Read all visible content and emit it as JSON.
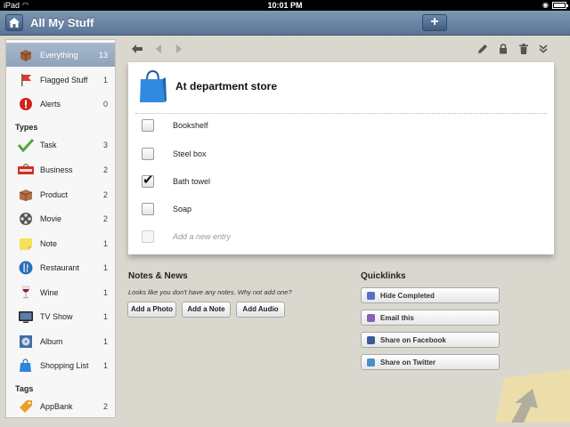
{
  "status": {
    "carrier": "iPad",
    "time": "10:01 PM"
  },
  "nav": {
    "title": "All My Stuff",
    "add_label": "+"
  },
  "sidebar": {
    "items": [
      {
        "label": "Everything",
        "count": "13",
        "icon": "box-icon"
      },
      {
        "label": "Flagged Stuff",
        "count": "1",
        "icon": "flag-icon"
      },
      {
        "label": "Alerts",
        "count": "0",
        "icon": "alert-icon"
      }
    ],
    "types_header": "Types",
    "types": [
      {
        "label": "Task",
        "count": "3",
        "icon": "checkmark-icon"
      },
      {
        "label": "Business",
        "count": "2",
        "icon": "open-sign-icon"
      },
      {
        "label": "Product",
        "count": "2",
        "icon": "package-icon"
      },
      {
        "label": "Movie",
        "count": "2",
        "icon": "film-reel-icon"
      },
      {
        "label": "Note",
        "count": "1",
        "icon": "sticky-note-icon"
      },
      {
        "label": "Restaurant",
        "count": "1",
        "icon": "fork-knife-icon"
      },
      {
        "label": "Wine",
        "count": "1",
        "icon": "wine-glass-icon"
      },
      {
        "label": "TV Show",
        "count": "1",
        "icon": "tv-icon"
      },
      {
        "label": "Album",
        "count": "1",
        "icon": "album-icon"
      },
      {
        "label": "Shopping List",
        "count": "1",
        "icon": "shopping-bag-icon"
      }
    ],
    "tags_header": "Tags",
    "tags": [
      {
        "label": "AppBank",
        "count": "2",
        "icon": "tag-icon"
      }
    ]
  },
  "card": {
    "title": "At department store",
    "entries": [
      {
        "text": "Bookshelf",
        "checked": false
      },
      {
        "text": "Steel box",
        "checked": false
      },
      {
        "text": "Bath towel",
        "checked": true
      },
      {
        "text": "Soap",
        "checked": false
      }
    ],
    "add_placeholder": "Add a new entry"
  },
  "notes": {
    "title": "Notes & News",
    "message": "Looks like you don't have any notes. Why not add one?",
    "add_photo": "Add a Photo",
    "add_note": "Add a Note",
    "add_audio": "Add Audio"
  },
  "quicklinks": {
    "title": "Quicklinks",
    "hide_completed": "Hide Completed",
    "email_this": "Email this",
    "share_facebook": "Share on Facebook",
    "share_twitter": "Share on Twitter"
  },
  "colors": {
    "nav": "#5a7597",
    "sidebar_active": "#8ea3bc",
    "background": "#dad7ce"
  }
}
